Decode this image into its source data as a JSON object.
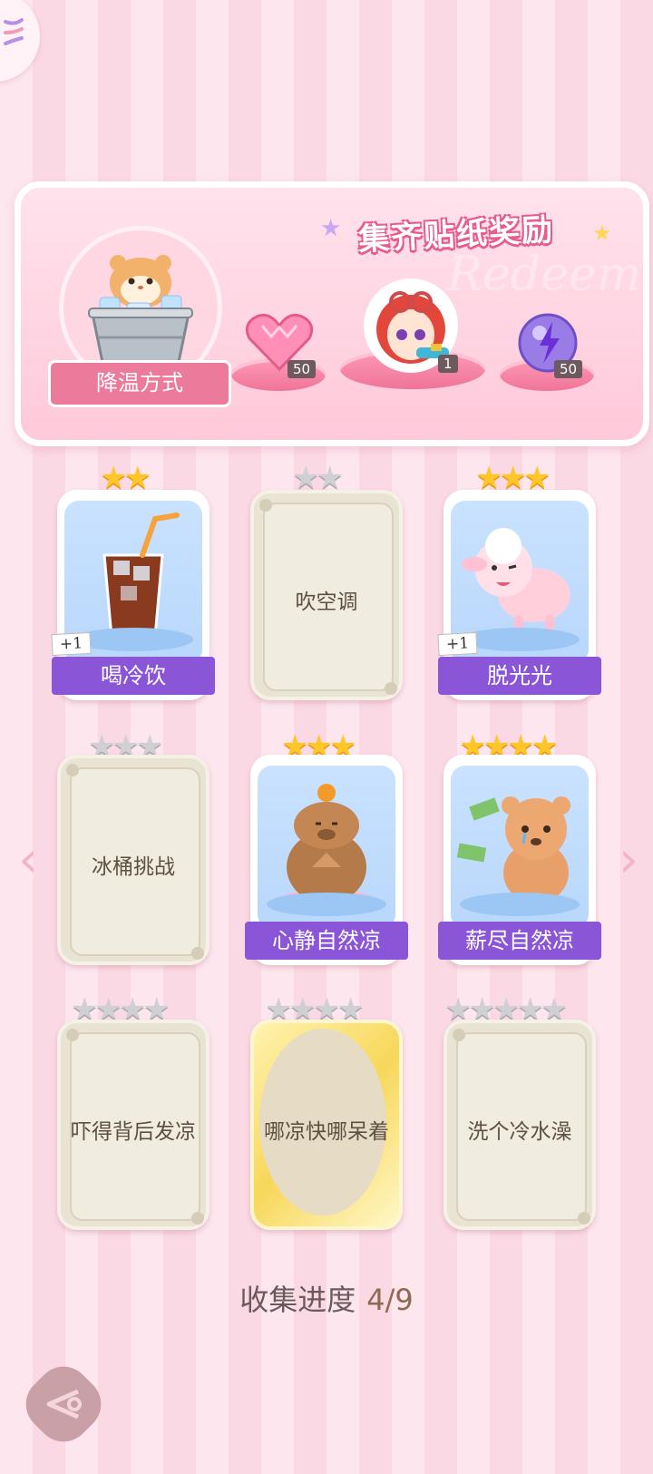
{
  "banner": {
    "title": "集齐贴纸奖励",
    "watermark": "Redeem",
    "category_label": "降温方式",
    "rewards": [
      {
        "icon": "pink-heart-gem-icon",
        "count": "50"
      },
      {
        "icon": "character-avatar-icon",
        "count": "1"
      },
      {
        "icon": "purple-lightning-orb-icon",
        "count": "50"
      }
    ]
  },
  "cards": [
    {
      "name": "喝冷饮",
      "stars": 2,
      "max": 2,
      "unlocked": true,
      "badge": "+1",
      "art": "iced-cola-icon"
    },
    {
      "name": "吹空调",
      "stars": 0,
      "max": 2,
      "unlocked": false
    },
    {
      "name": "脱光光",
      "stars": 3,
      "max": 3,
      "unlocked": true,
      "badge": "+1",
      "art": "pink-sheep-icon"
    },
    {
      "name": "冰桶挑战",
      "stars": 0,
      "max": 3,
      "unlocked": false
    },
    {
      "name": "心静自然凉",
      "stars": 3,
      "max": 3,
      "unlocked": true,
      "art": "capybara-icon"
    },
    {
      "name": "薪尽自然凉",
      "stars": 4,
      "max": 4,
      "unlocked": true,
      "art": "crying-bear-icon"
    },
    {
      "name": "吓得背后发凉",
      "stars": 0,
      "max": 4,
      "unlocked": false
    },
    {
      "name": "哪凉快哪呆着",
      "stars": 0,
      "max": 4,
      "unlocked": false,
      "gold": true
    },
    {
      "name": "洗个冷水澡",
      "stars": 0,
      "max": 5,
      "unlocked": false
    }
  ],
  "progress": {
    "label": "收集进度",
    "value": "4/9"
  },
  "colors": {
    "accent_purple": "#8a55d6",
    "accent_pink": "#ec7a9b",
    "star_gold": "#ffc629"
  }
}
